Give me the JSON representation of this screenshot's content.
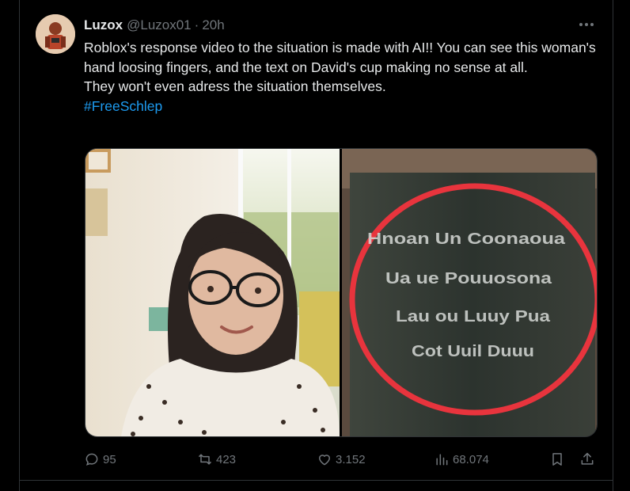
{
  "tweet": {
    "display_name": "Luzox",
    "handle": "@Luzox01",
    "separator": "·",
    "time": "20h",
    "text_lines": [
      "Roblox's response video to the situation is made with AI!! You can see this woman's hand loosing fingers, and the text on David's cup making no sense at all.",
      "They won't even adress the situation themselves."
    ],
    "hashtag": "#FreeSchlep"
  },
  "actions": {
    "replies": "95",
    "reposts": "423",
    "likes": "3.152",
    "views": "68.074"
  },
  "media": {
    "left": "woman-with-glasses-frame",
    "right": "cup-closeup-with-red-circle"
  },
  "colors": {
    "background": "#000000",
    "text": "#e7e9ea",
    "muted": "#71767b",
    "link": "#1d9bf0",
    "border": "#2f3336",
    "highlight_circle": "#e8343d"
  }
}
